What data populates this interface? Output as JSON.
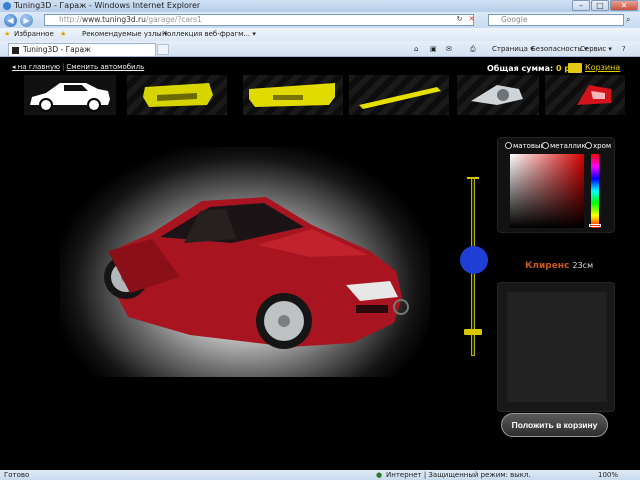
{
  "window": {
    "title": "Tuning3D - Гараж - Windows Internet Explorer",
    "minimize": "–",
    "maximize": "□",
    "close": "✕"
  },
  "address": {
    "back": "◀",
    "forward": "▶",
    "url_prefix": "http://",
    "url_host": "www.tuning3d.ru",
    "url_path": "/garage/?cars1",
    "refresh": "↻",
    "stop": "✕",
    "search_placeholder": "Google",
    "search_go": "⌕"
  },
  "favorites_bar": {
    "favorites": "Избранное",
    "recommended": "Рекомендуемые узлы ▾",
    "webslices": "Коллекция веб-фрагм... ▾"
  },
  "tabs": [
    {
      "label": "Tuning3D - Гараж"
    }
  ],
  "command_bar": {
    "page": "Страница ▾",
    "safety": "Безопасность ▾",
    "tools": "Сервис ▾",
    "help": "?"
  },
  "site": {
    "home_link": "◂ на главную",
    "separator": "|",
    "change_car_link": "Сменить автомобиль",
    "total_label": "Общая сумма:",
    "total_value": "0 р.",
    "cart_link": "Корзина"
  },
  "parts": [
    {
      "name": "car-body",
      "icon": "car-silhouette-icon"
    },
    {
      "name": "front-bumper",
      "icon": "front-bumper-icon"
    },
    {
      "name": "rear-bumper",
      "icon": "rear-bumper-icon"
    },
    {
      "name": "side-skirt",
      "icon": "side-skirt-icon"
    },
    {
      "name": "headlight",
      "icon": "headlight-icon"
    },
    {
      "name": "taillight",
      "icon": "taillight-icon"
    }
  ],
  "paint": {
    "finishes": [
      "матовый",
      "металлик",
      "хром"
    ],
    "selected_color": "#b0121f"
  },
  "clearance": {
    "label": "Клиренс",
    "value": "23см"
  },
  "add_to_cart": "Положить в корзину",
  "status": {
    "left": "Готово",
    "zone": "Интернет | Защищенный режим: выкл.",
    "zoom": "100%"
  },
  "colors": {
    "accent": "#e6d300",
    "clearance": "#c8571e",
    "car": "#b0121f"
  }
}
